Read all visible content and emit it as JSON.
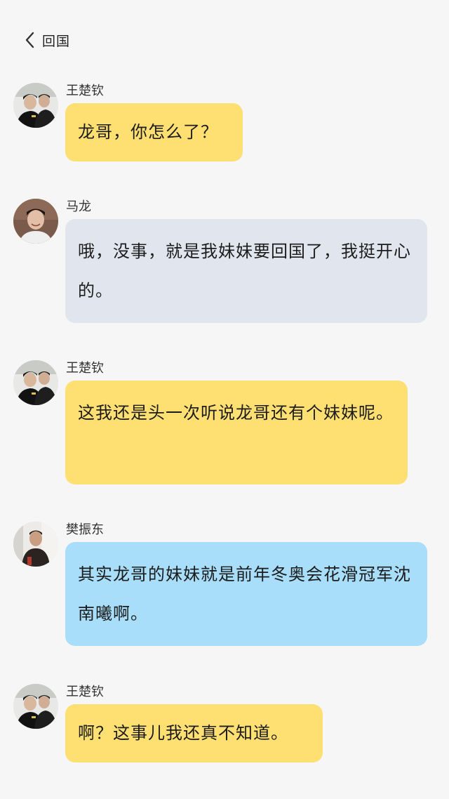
{
  "header": {
    "back_label": "回国"
  },
  "colors": {
    "yellow": "#fedf72",
    "gray": "#e1e6ee",
    "blue": "#a8def9",
    "background": "#f6f6f6"
  },
  "messages": [
    {
      "sender": "王楚钦",
      "text": "龙哥，你怎么了？",
      "bubble_color": "yellow",
      "avatar": "avatar-wang"
    },
    {
      "sender": "马龙",
      "text": "哦，没事，就是我妹妹要回国了，我挺开心的。",
      "bubble_color": "gray",
      "avatar": "avatar-ma"
    },
    {
      "sender": "王楚钦",
      "text": "这我还是头一次听说龙哥还有个妹妹呢。",
      "bubble_color": "yellow",
      "avatar": "avatar-wang"
    },
    {
      "sender": "樊振东",
      "text": "其实龙哥的妹妹就是前年冬奥会花滑冠军沈南曦啊。",
      "bubble_color": "blue",
      "avatar": "avatar-fan"
    },
    {
      "sender": "王楚钦",
      "text": "啊？这事儿我还真不知道。",
      "bubble_color": "yellow",
      "avatar": "avatar-wang"
    }
  ]
}
